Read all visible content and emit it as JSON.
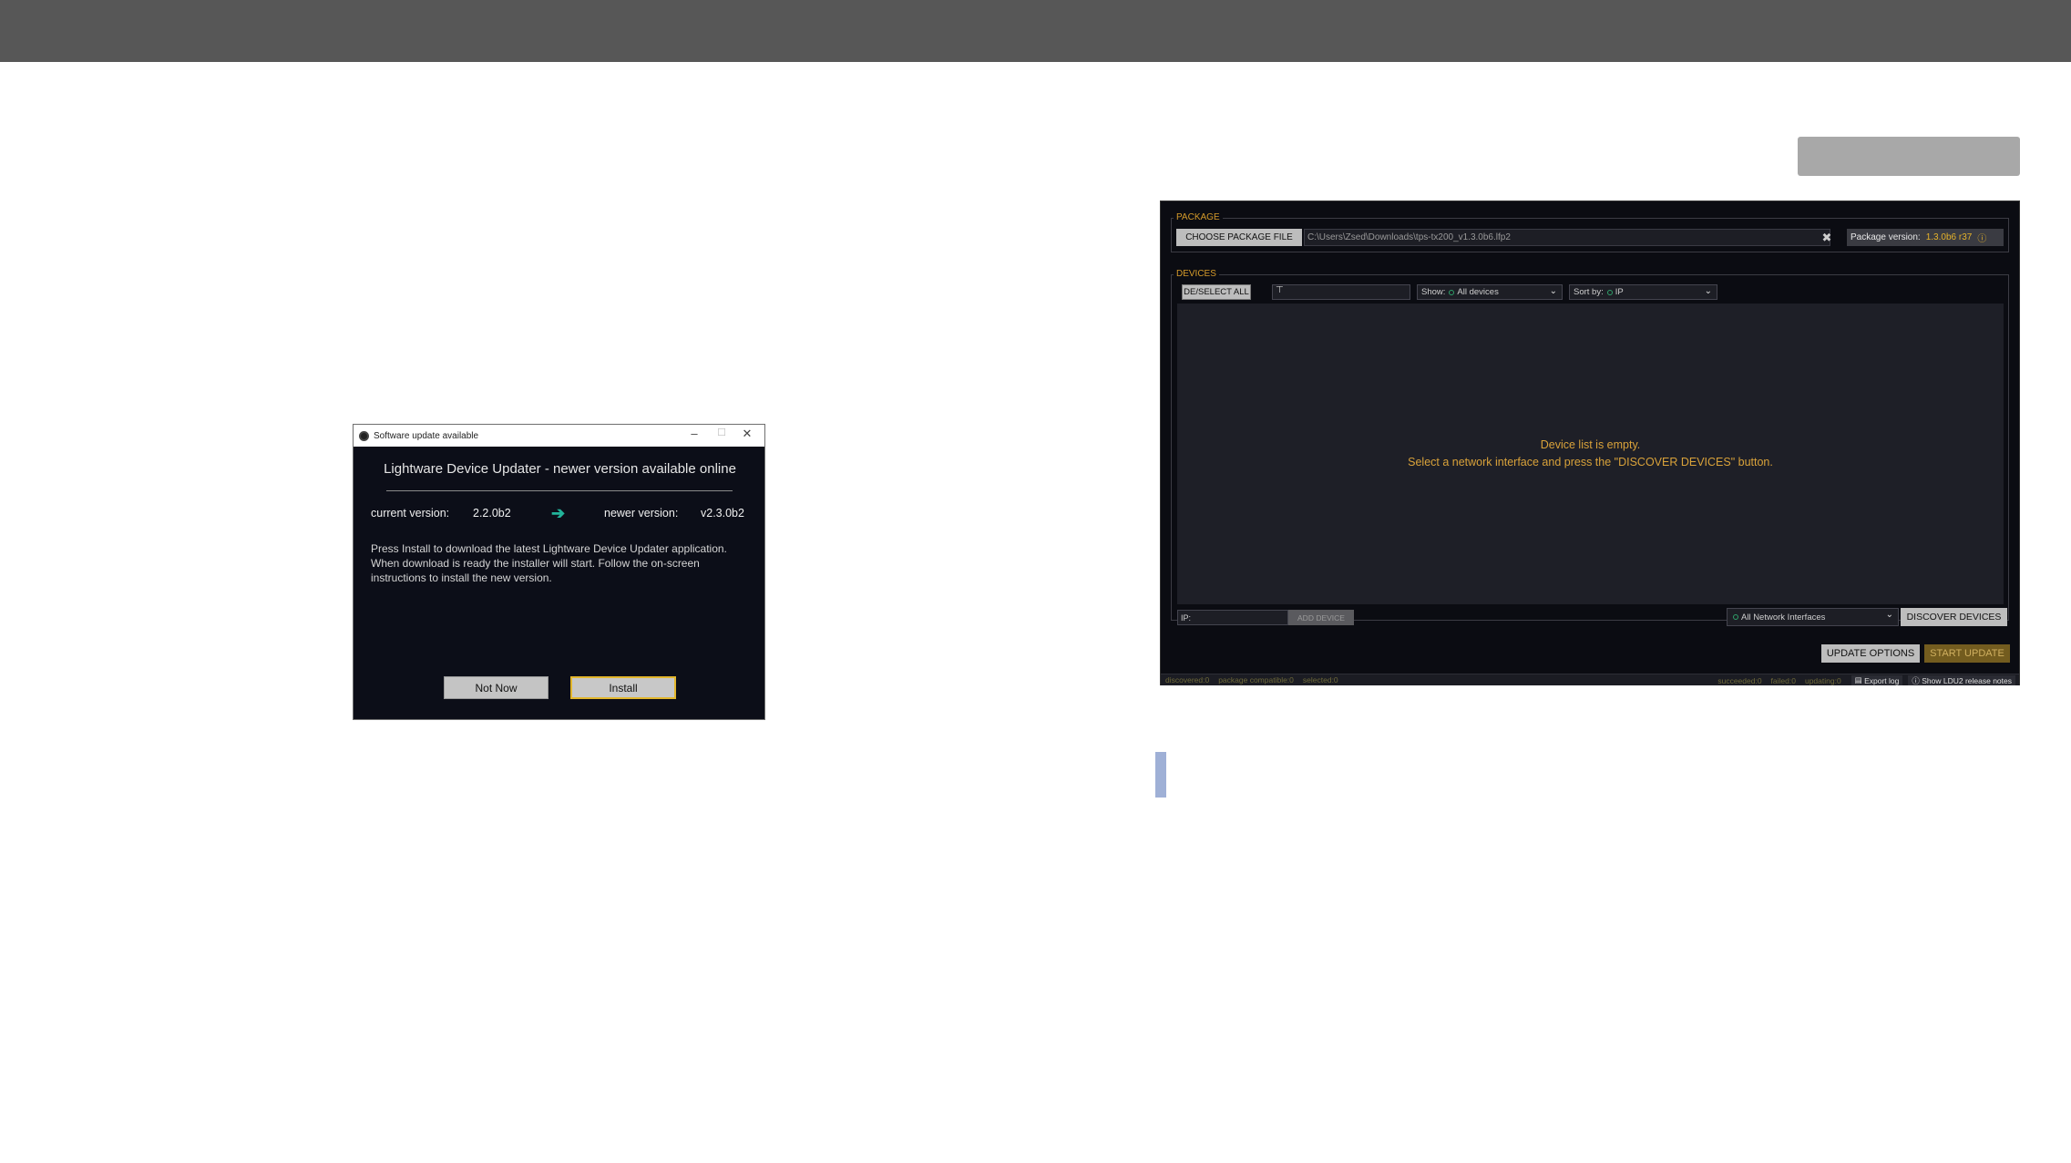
{
  "dialog": {
    "title": "Software update available",
    "win_minimize": "–",
    "win_maximize": "☐",
    "win_close": "✕",
    "heading": "Lightware Device Updater - newer version available online",
    "current_label": "current version:",
    "current_value": "2.2.0b2",
    "newer_label": "newer version:",
    "newer_value": "v2.3.0b2",
    "message": "Press Install to download the latest Lightware Device Updater application. When download is ready the installer will start. Follow the on-screen instructions to install the new version.",
    "btn_not_now": "Not Now",
    "btn_install": "Install"
  },
  "ldu": {
    "package": {
      "legend": "PACKAGE",
      "choose_button": "CHOOSE PACKAGE FILE",
      "path": "C:\\Users\\Zsed\\Downloads\\tps-tx200_v1.3.0b6.lfp2",
      "version_label": "Package version:",
      "version_value": "1.3.0b6 r37"
    },
    "devices": {
      "legend": "DEVICES",
      "deselect_button": "DE/SELECT ALL",
      "filter_placeholder": "",
      "show_label": "Show:",
      "show_value": "All devices",
      "sort_label": "Sort by:",
      "sort_value": "IP",
      "empty_line1": "Device list is empty.",
      "empty_line2": "Select a network interface and press the \"DISCOVER DEVICES\" button.",
      "ip_label": "IP:",
      "add_device": "ADD DEVICE",
      "interface_value": "All Network Interfaces",
      "discover_button": "DISCOVER DEVICES"
    },
    "update_options": "UPDATE OPTIONS",
    "start_update": "START UPDATE",
    "status": {
      "discovered": "discovered:0",
      "compatible": "package compatible:0",
      "selected": "selected:0",
      "succeeded": "succeeded:0",
      "failed": "failed:0",
      "updating": "updating:0",
      "export_log": "Export log",
      "release_notes": "Show LDU2 release notes"
    }
  }
}
